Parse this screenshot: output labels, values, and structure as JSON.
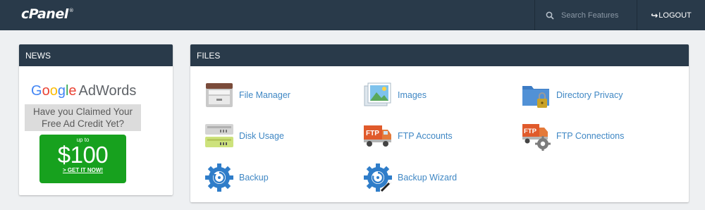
{
  "header": {
    "logo": "cPanel",
    "logo_mark": "®",
    "search_placeholder": "Search Features",
    "logout_label": "LOGOUT"
  },
  "news": {
    "title": "NEWS",
    "ad": {
      "brand_google": [
        "G",
        "o",
        "o",
        "g",
        "l",
        "e"
      ],
      "brand_adwords": "AdWords",
      "headline_line1": "Have you Claimed Your",
      "headline_line2": "Free Ad Credit Yet?",
      "up_to": "up to",
      "amount": "$100",
      "cta": "> GET IT NOW!"
    }
  },
  "files": {
    "title": "FILES",
    "items": [
      {
        "label": "File Manager",
        "icon": "file-manager-icon"
      },
      {
        "label": "Images",
        "icon": "images-icon"
      },
      {
        "label": "Directory Privacy",
        "icon": "directory-privacy-icon"
      },
      {
        "label": "Disk Usage",
        "icon": "disk-usage-icon"
      },
      {
        "label": "FTP Accounts",
        "icon": "ftp-accounts-icon"
      },
      {
        "label": "FTP Connections",
        "icon": "ftp-connections-icon"
      },
      {
        "label": "Backup",
        "icon": "backup-icon"
      },
      {
        "label": "Backup Wizard",
        "icon": "backup-wizard-icon"
      }
    ]
  },
  "colors": {
    "header_bg": "#293a4a",
    "link": "#3f87c4",
    "ad_green": "#17a11e"
  }
}
